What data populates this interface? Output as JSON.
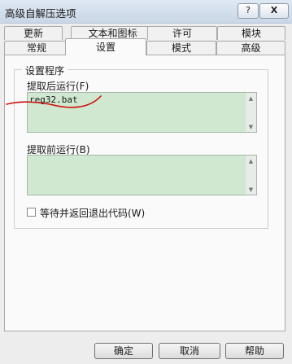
{
  "window": {
    "title": "高级自解压选项",
    "help_glyph": "?",
    "close_glyph": "X"
  },
  "tabs": {
    "row1": [
      "更新",
      "文本和图标",
      "许可",
      "模块"
    ],
    "row2": [
      "常规",
      "设置",
      "模式",
      "高级"
    ],
    "active": "设置"
  },
  "group": {
    "legend": "设置程序",
    "after_label": "提取后运行(F)",
    "after_value": "reg32.bat",
    "before_label": "提取前运行(B)",
    "before_value": "",
    "wait_label": "等待并返回退出代码(W)",
    "wait_checked": false
  },
  "buttons": {
    "ok": "确定",
    "cancel": "取消",
    "help": "帮助"
  },
  "icons": {
    "scroll_up": "up-arrow-icon",
    "scroll_down": "down-arrow-icon"
  },
  "colors": {
    "textarea_bg": "#cfe8cf",
    "annotation": "#d01010"
  }
}
